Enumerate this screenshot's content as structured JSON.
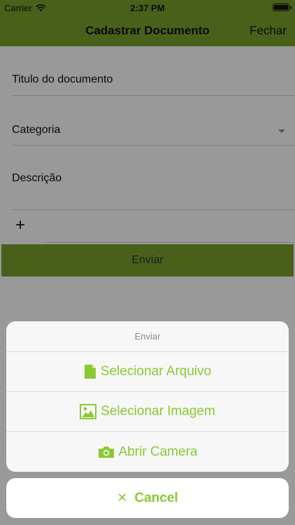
{
  "status_bar": {
    "carrier": "Carrier",
    "time": "2:37 PM"
  },
  "nav": {
    "title": "Cadastrar Documento",
    "close_label": "Fechar"
  },
  "form": {
    "title_placeholder": "Titulo do documento",
    "category_placeholder": "Categoria",
    "description_placeholder": "Descrição",
    "add_icon": "plus-icon",
    "submit_label": "Enviar"
  },
  "action_sheet": {
    "title": "Enviar",
    "actions": [
      {
        "label": "Selecionar Arquivo",
        "icon": "file-icon"
      },
      {
        "label": "Selecionar Imagem",
        "icon": "image-icon"
      },
      {
        "label": "Abrir Camera",
        "icon": "camera-icon"
      }
    ],
    "cancel_label": "Cancel",
    "cancel_icon": "close-icon"
  },
  "colors": {
    "brand_green": "#7aa02c",
    "action_green": "#8ac932"
  }
}
